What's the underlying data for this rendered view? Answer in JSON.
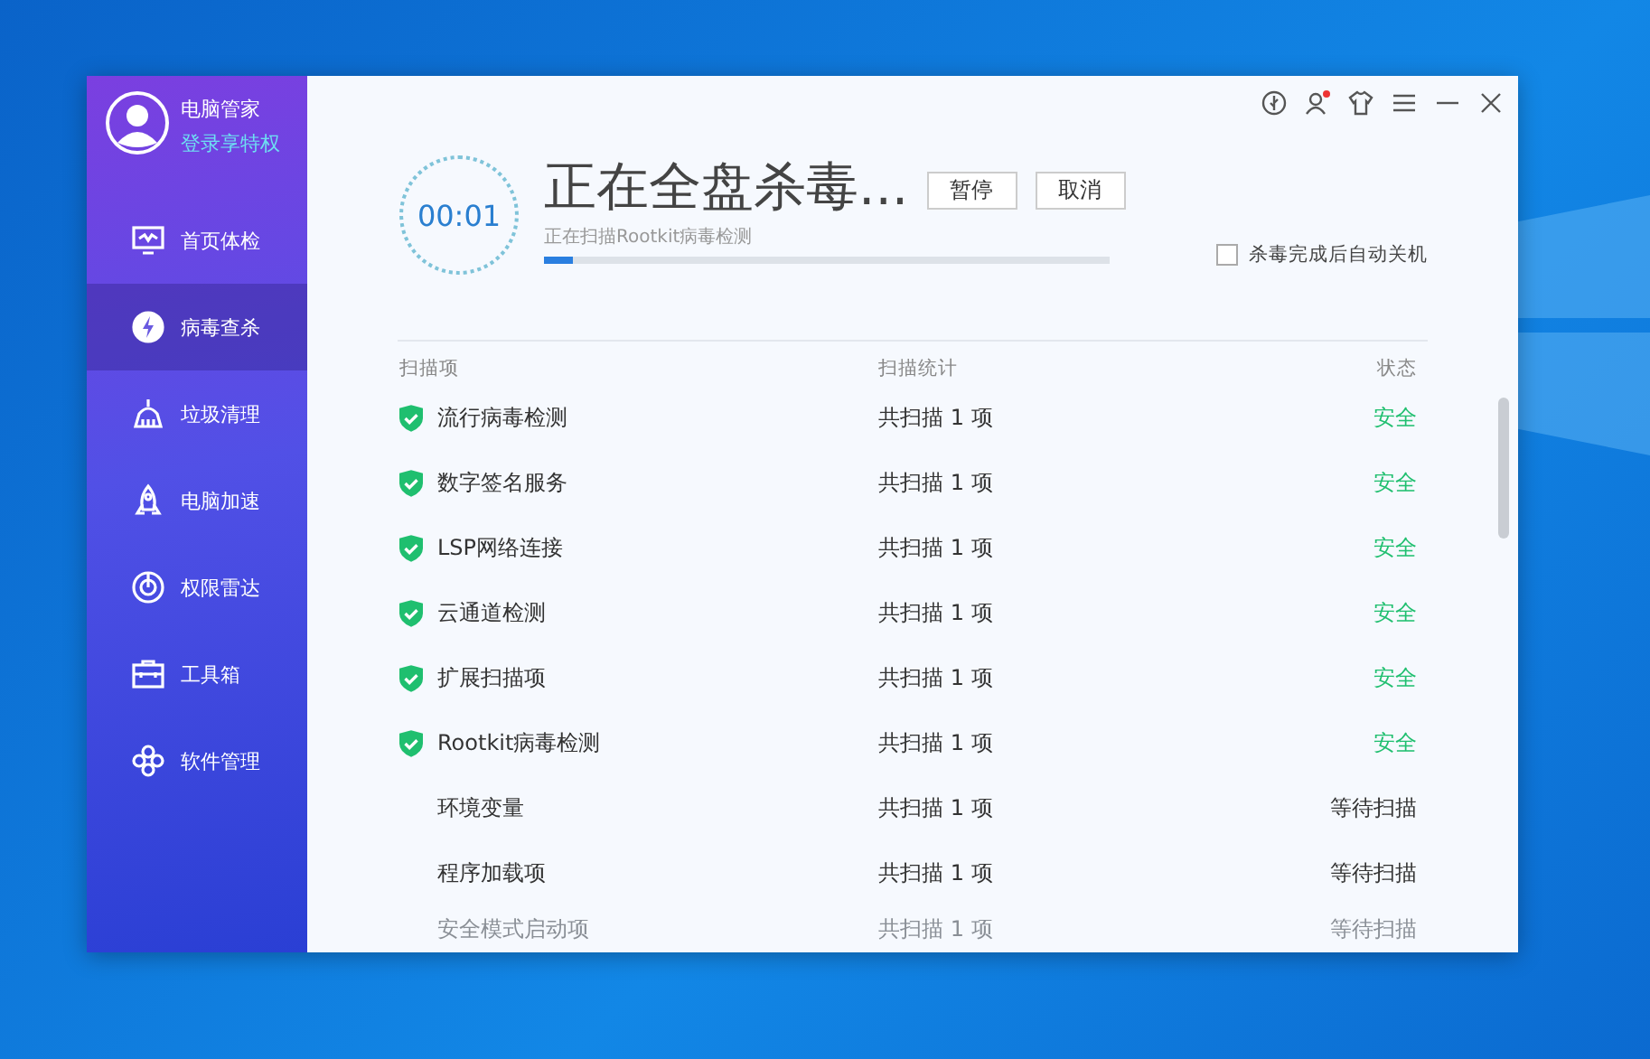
{
  "user": {
    "name": "电脑管家",
    "login_link": "登录享特权"
  },
  "sidebar": {
    "items": [
      {
        "label": "首页体检",
        "selected": false
      },
      {
        "label": "病毒查杀",
        "selected": true
      },
      {
        "label": "垃圾清理",
        "selected": false
      },
      {
        "label": "电脑加速",
        "selected": false
      },
      {
        "label": "权限雷达",
        "selected": false
      },
      {
        "label": "工具箱",
        "selected": false
      },
      {
        "label": "软件管理",
        "selected": false
      }
    ]
  },
  "scan": {
    "timer": "00:01",
    "title": "正在全盘杀毒...",
    "subtitle": "正在扫描Rootkit病毒检测",
    "progress": {
      "level": 0.05
    },
    "buttons": [
      "暂停",
      "取消"
    ],
    "auto_shutdown": {
      "label": "杀毒完成后自动关机",
      "checked": false
    }
  },
  "table": {
    "columns": [
      "扫描项",
      "扫描统计",
      "状态"
    ],
    "rows": [
      {
        "item": "流行病毒检测",
        "count": "共扫描 1 项",
        "status": "安全",
        "kind": "safe",
        "faded": false
      },
      {
        "item": "数字签名服务",
        "count": "共扫描 1 项",
        "status": "安全",
        "kind": "safe",
        "faded": false
      },
      {
        "item": "LSP网络连接",
        "count": "共扫描 1 项",
        "status": "安全",
        "kind": "safe",
        "faded": false
      },
      {
        "item": "云通道检测",
        "count": "共扫描 1 项",
        "status": "安全",
        "kind": "safe",
        "faded": false
      },
      {
        "item": "扩展扫描项",
        "count": "共扫描 1 项",
        "status": "安全",
        "kind": "safe",
        "faded": false
      },
      {
        "item": "Rootkit病毒检测",
        "count": "共扫描 1 项",
        "status": "安全",
        "kind": "safe",
        "faded": false
      },
      {
        "item": "环境变量",
        "count": "共扫描 1 项",
        "status": "等待扫描",
        "kind": "waiting",
        "faded": false
      },
      {
        "item": "程序加载项",
        "count": "共扫描 1 项",
        "status": "等待扫描",
        "kind": "waiting",
        "faded": false
      },
      {
        "item": "安全模式启动项",
        "count": "共扫描 1 项",
        "status": "等待扫描",
        "kind": "waiting",
        "faded": true
      }
    ]
  }
}
